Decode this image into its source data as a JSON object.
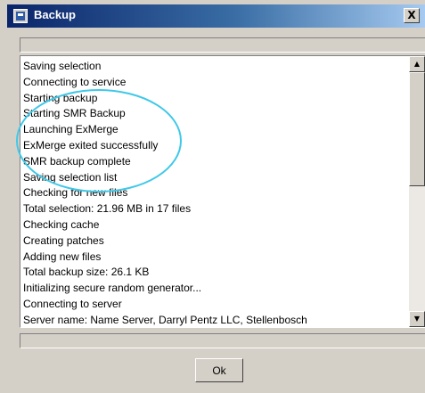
{
  "window": {
    "title": "Backup",
    "close_label": "X",
    "app_icon": "backup-app-icon"
  },
  "log": {
    "lines": [
      "Saving selection",
      "Connecting to service",
      "Starting backup",
      "Starting SMR Backup",
      "Launching ExMerge",
      "ExMerge exited successfully",
      "SMR backup complete",
      "Saving selection list",
      "Checking for new files",
      "Total selection: 21.96 MB in 17 files",
      "Checking cache",
      "Creating patches",
      "Adding new files",
      "Total backup size: 26.1 KB",
      "Initializing secure random generator...",
      "Connecting to server",
      "Server name: Name Server, Darryl Pentz LLC, Stellenbosch"
    ]
  },
  "scrollbar": {
    "up_icon": "arrow-up-icon",
    "down_icon": "arrow-down-icon"
  },
  "buttons": {
    "ok_label": "Ok"
  },
  "annotation": {
    "color": "#3fc8e8",
    "shape": "ellipse"
  }
}
